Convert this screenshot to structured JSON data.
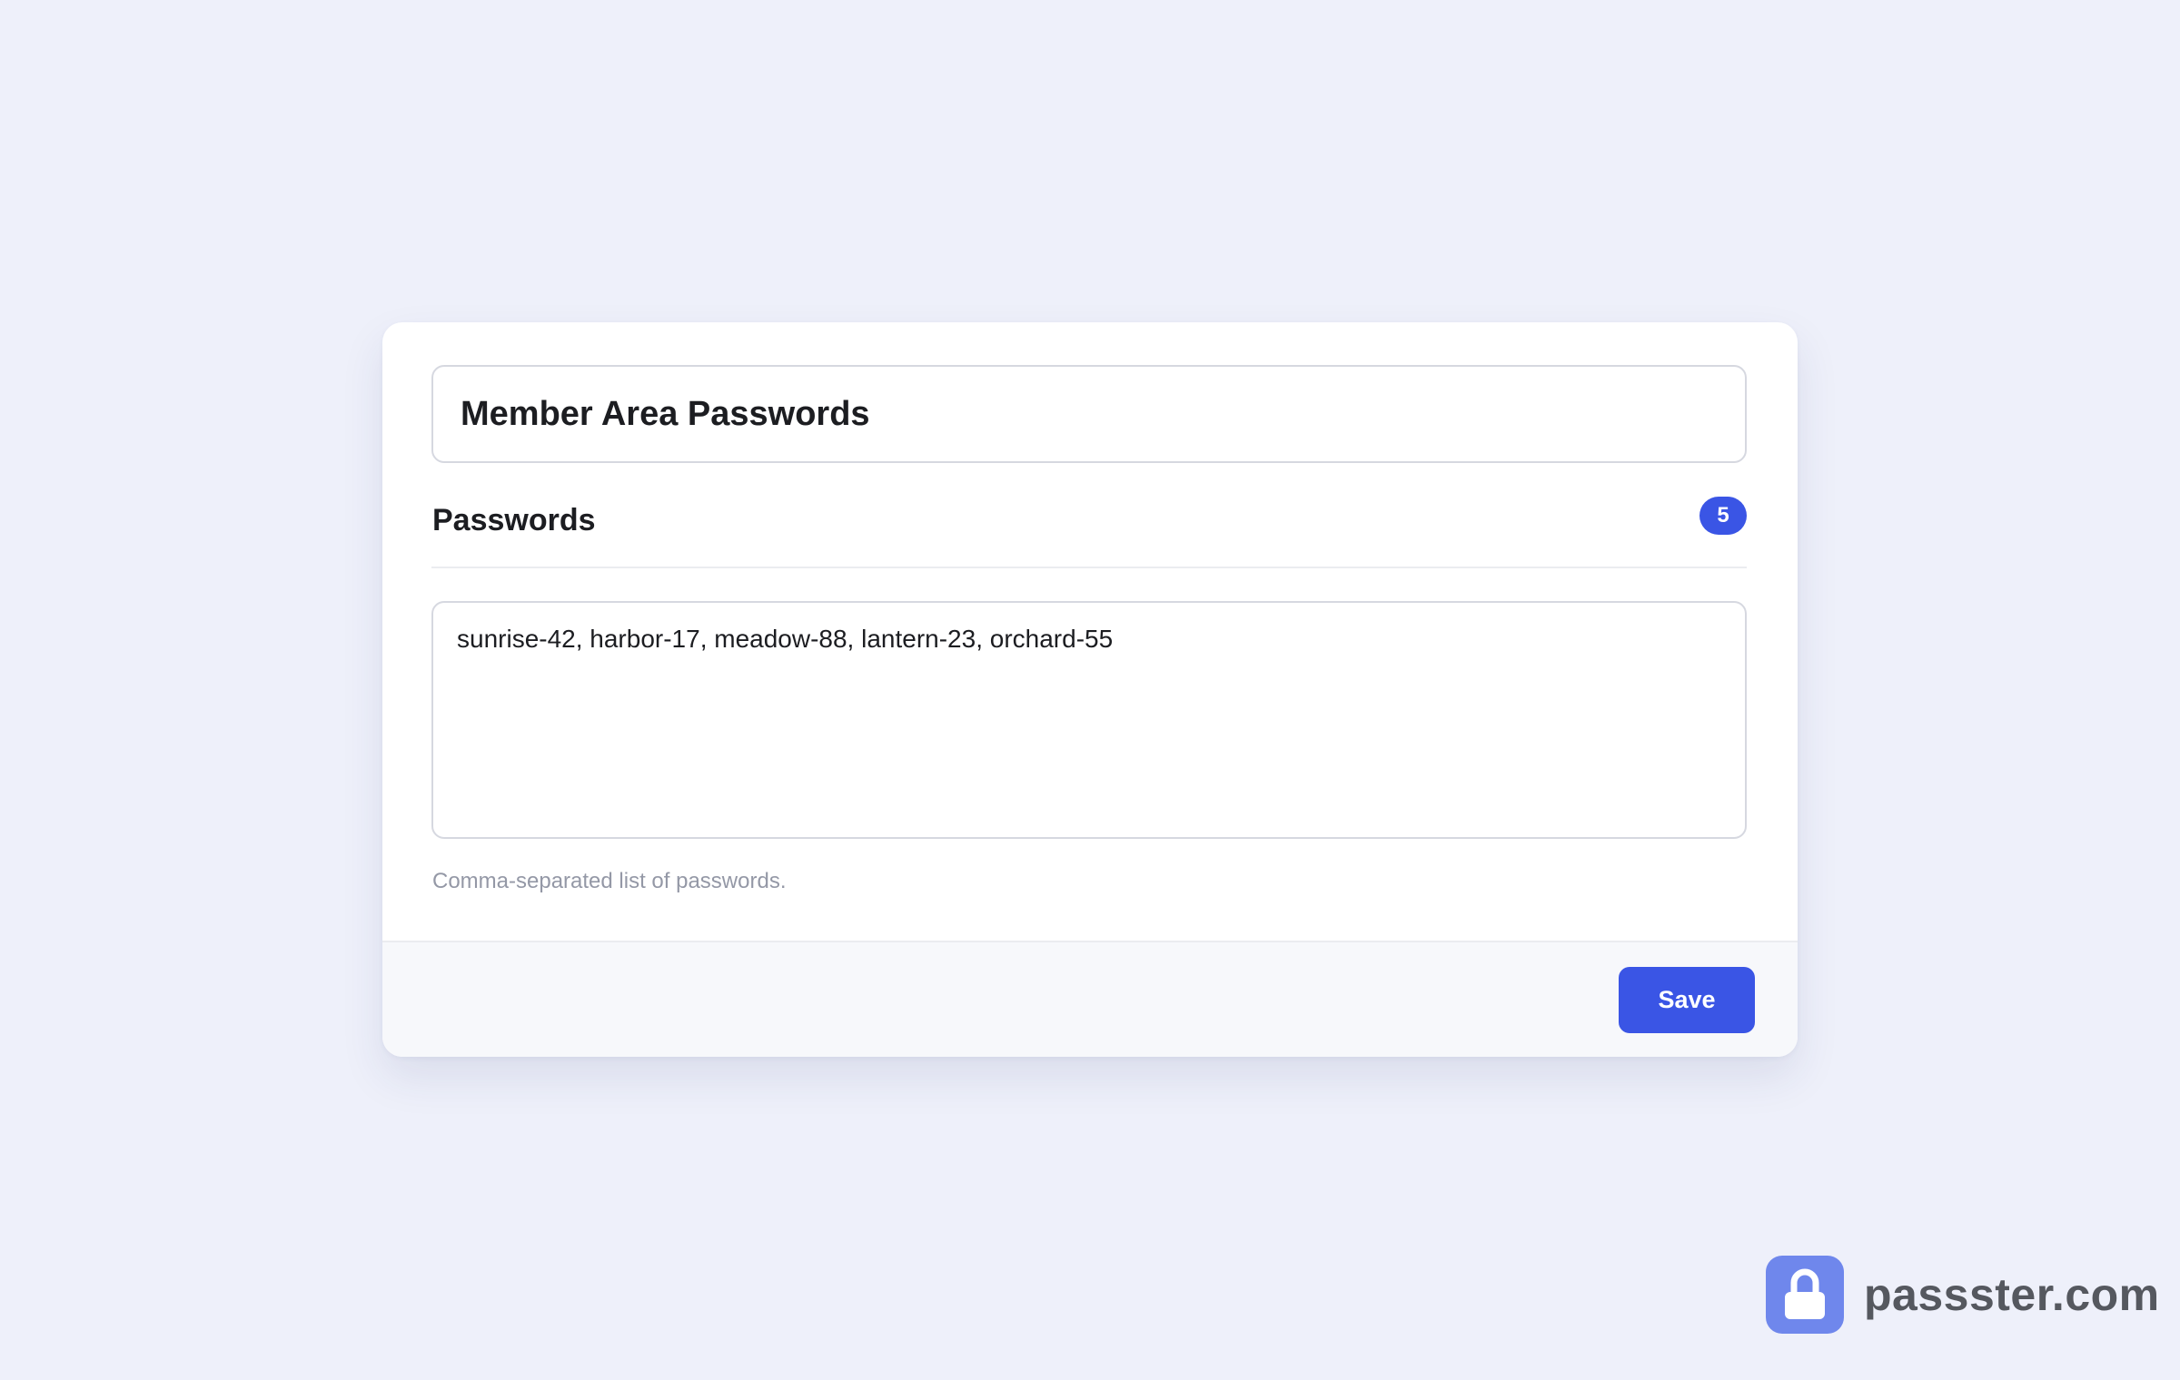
{
  "card": {
    "title_value": "Member Area Passwords",
    "section_label": "Passwords",
    "password_count": "5",
    "passwords_value": "sunrise-42, harbor-17, meadow-88, lantern-23, orchard-55",
    "help_text": "Comma-separated list of passwords.",
    "save_label": "Save"
  },
  "brand": {
    "icon": "lock-icon",
    "name": "passster.com"
  },
  "colors": {
    "background": "#eef0fa",
    "accent": "#3a55e5",
    "brand_icon": "#6f87ec"
  }
}
